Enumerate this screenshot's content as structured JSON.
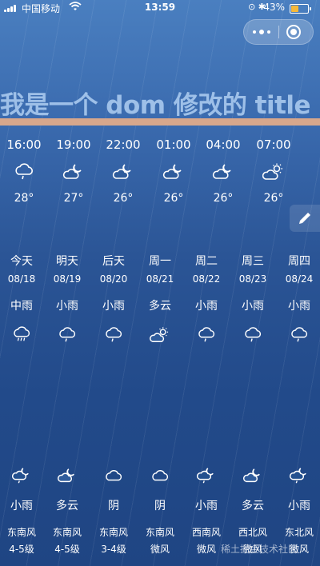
{
  "status_bar": {
    "carrier": "中国移动",
    "time": "13:59",
    "battery": "43%",
    "battery_level": 0.43
  },
  "title": "我是一个 dom 修改的 title",
  "hourly": [
    {
      "time": "16:00",
      "icon": "cloud-rain",
      "temp": "28°"
    },
    {
      "time": "19:00",
      "icon": "cloud-moon",
      "temp": "27°"
    },
    {
      "time": "22:00",
      "icon": "cloud-moon",
      "temp": "26°"
    },
    {
      "time": "01:00",
      "icon": "cloud-moon",
      "temp": "26°"
    },
    {
      "time": "04:00",
      "icon": "cloud-moon",
      "temp": "26°"
    },
    {
      "time": "07:00",
      "icon": "cloud-sun",
      "temp": "26°"
    }
  ],
  "daily": [
    {
      "weekday": "今天",
      "date": "08/18",
      "day_weather": "中雨",
      "day_icon": "cloud-heavy-rain",
      "night_icon": "cloud-moon-rain",
      "night_weather": "小雨",
      "wind_dir": "东南风",
      "wind_level": "4-5级"
    },
    {
      "weekday": "明天",
      "date": "08/19",
      "day_weather": "小雨",
      "day_icon": "cloud-rain",
      "night_icon": "cloud-moon",
      "night_weather": "多云",
      "wind_dir": "东南风",
      "wind_level": "4-5级"
    },
    {
      "weekday": "后天",
      "date": "08/20",
      "day_weather": "小雨",
      "day_icon": "cloud-rain",
      "night_icon": "cloud",
      "night_weather": "阴",
      "wind_dir": "东南风",
      "wind_level": "3-4级"
    },
    {
      "weekday": "周一",
      "date": "08/21",
      "day_weather": "多云",
      "day_icon": "cloud-sun",
      "night_icon": "cloud",
      "night_weather": "阴",
      "wind_dir": "东南风",
      "wind_level": "微风"
    },
    {
      "weekday": "周二",
      "date": "08/22",
      "day_weather": "小雨",
      "day_icon": "cloud-rain",
      "night_icon": "cloud-moon-rain",
      "night_weather": "小雨",
      "wind_dir": "西南风",
      "wind_level": "微风"
    },
    {
      "weekday": "周三",
      "date": "08/23",
      "day_weather": "小雨",
      "day_icon": "cloud-rain",
      "night_icon": "cloud-moon",
      "night_weather": "多云",
      "wind_dir": "西北风",
      "wind_level": "微风"
    },
    {
      "weekday": "周四",
      "date": "08/24",
      "day_weather": "小雨",
      "day_icon": "cloud-rain",
      "night_icon": "cloud-moon-rain",
      "night_weather": "小雨",
      "wind_dir": "东北风",
      "wind_level": "微风"
    }
  ],
  "watermark": "稀土掘金技术社区",
  "colors": {
    "title_text": "#9ec0e8",
    "title_bar": "#d7a78c",
    "battery_fill": "#f5b83a"
  }
}
